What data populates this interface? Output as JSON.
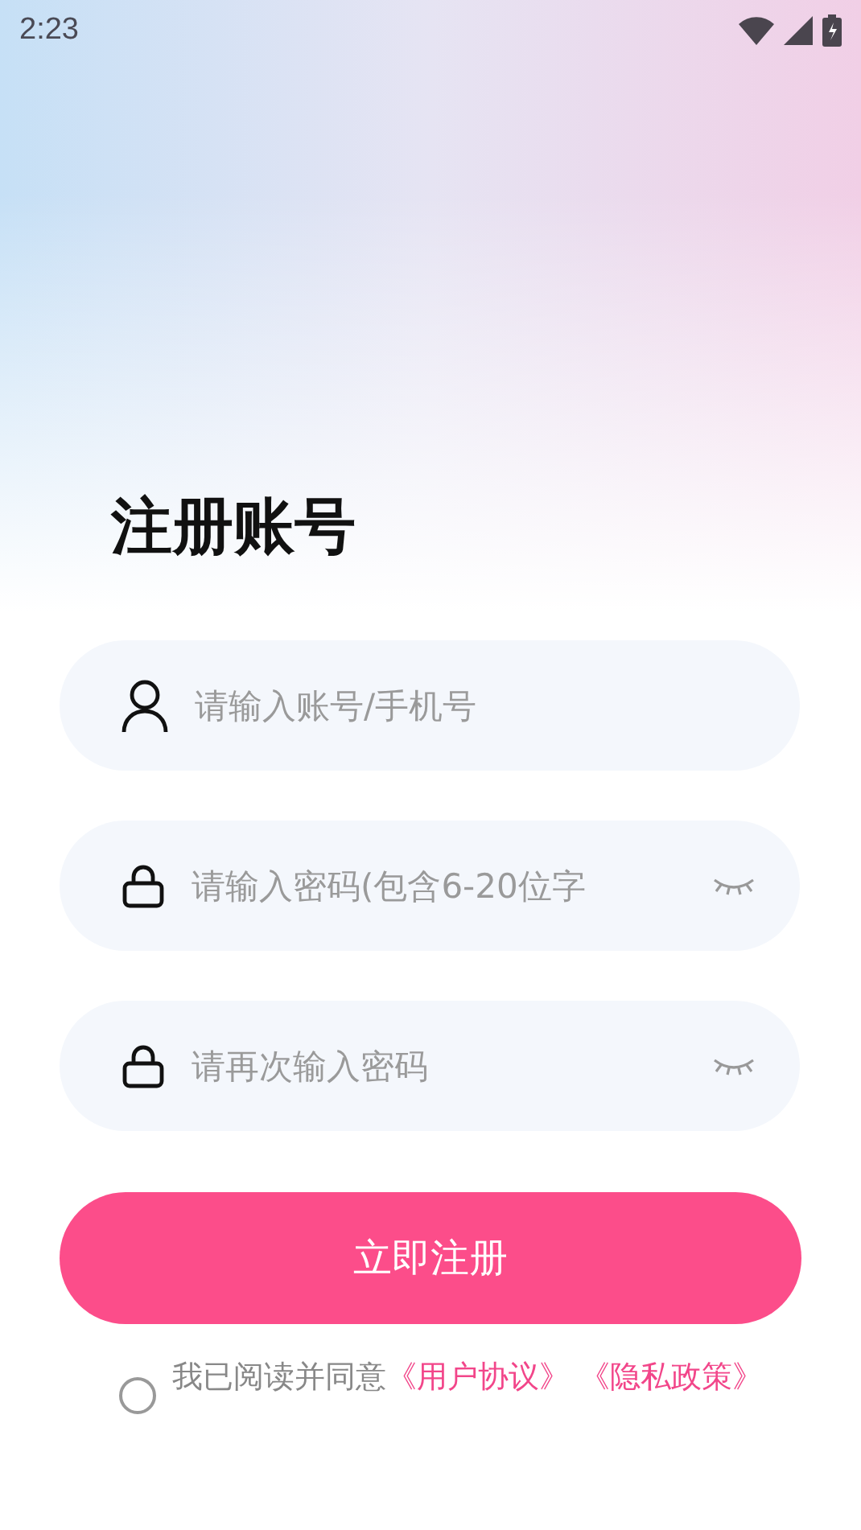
{
  "status_bar": {
    "time": "2:23"
  },
  "title": "注册账号",
  "fields": [
    {
      "kind": "user",
      "placeholder": "请输入账号/手机号",
      "reveal_toggle": false
    },
    {
      "kind": "lock",
      "placeholder": "请输入密码(包含6-20位字",
      "reveal_toggle": true
    },
    {
      "kind": "lock",
      "placeholder": "请再次输入密码",
      "reveal_toggle": true
    }
  ],
  "submit_button": "立即注册",
  "agreement": {
    "checked": false,
    "text": "我已阅读并同意",
    "links": [
      "《用户协议》",
      "《隐私政策》"
    ]
  }
}
